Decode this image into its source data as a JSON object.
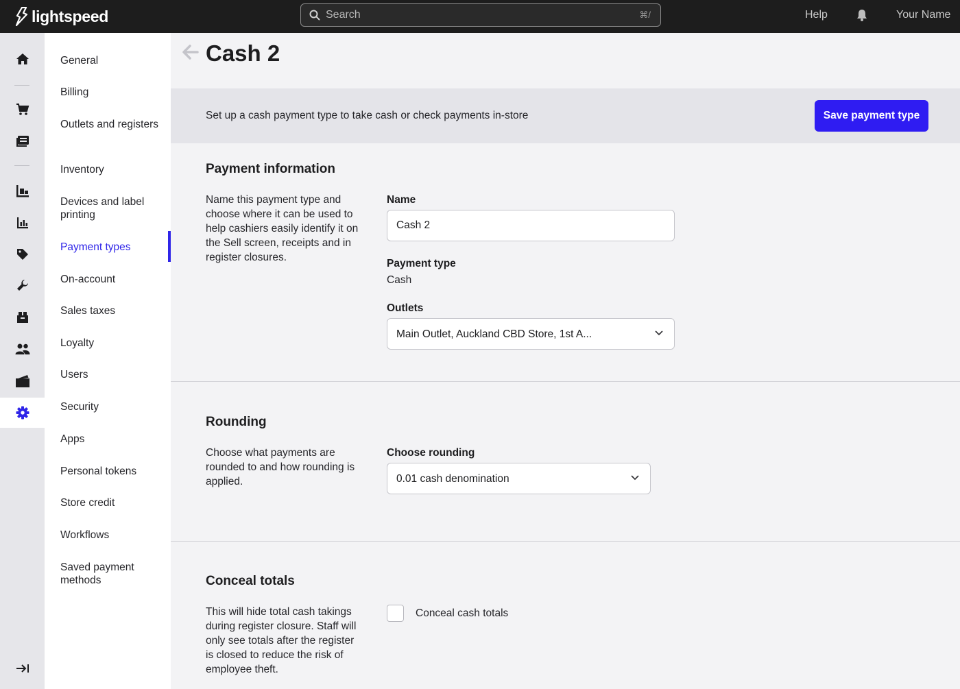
{
  "topbar": {
    "brand": "lightspeed",
    "search_placeholder": "Search",
    "search_shortcut": "⌘/",
    "help": "Help",
    "user_name": "Your Name"
  },
  "rail": {
    "icons": [
      "home-icon",
      "cart-icon",
      "register-icon",
      "products-icon",
      "reports-icon",
      "tag-icon",
      "wrench-icon",
      "inventory-icon",
      "customers-icon",
      "cash-icon",
      "settings-icon",
      "collapse-icon"
    ],
    "active": "settings-icon"
  },
  "sidebar": {
    "items": [
      {
        "label": "General"
      },
      {
        "label": "Billing"
      },
      {
        "label": "Outlets and registers"
      },
      {
        "label": "Inventory"
      },
      {
        "label": "Devices and label printing"
      },
      {
        "label": "Payment types"
      },
      {
        "label": "On-account"
      },
      {
        "label": "Sales taxes"
      },
      {
        "label": "Loyalty"
      },
      {
        "label": "Users"
      },
      {
        "label": "Security"
      },
      {
        "label": "Apps"
      },
      {
        "label": "Personal tokens"
      },
      {
        "label": "Store credit"
      },
      {
        "label": "Workflows"
      },
      {
        "label": "Saved payment methods"
      }
    ],
    "active": "Payment types"
  },
  "page": {
    "title": "Cash 2",
    "banner_text": "Set up a cash payment type to take cash or check payments in-store",
    "save_label": "Save payment type"
  },
  "payment_info": {
    "title": "Payment information",
    "description": "Name this payment type and choose where it can be used to help cashiers easily identify it on the Sell screen, receipts and in register closures.",
    "name_label": "Name",
    "name_value": "Cash 2",
    "type_label": "Payment type",
    "type_value": "Cash",
    "outlets_label": "Outlets",
    "outlets_value": "Main Outlet, Auckland CBD Store, 1st A..."
  },
  "rounding": {
    "title": "Rounding",
    "description": "Choose what payments are rounded to and how rounding is applied.",
    "label": "Choose rounding",
    "value": "0.01 cash denomination"
  },
  "conceal": {
    "title": "Conceal totals",
    "description": "This will hide total cash takings during register closure. Staff will only see totals after the register is closed to reduce the risk of employee theft.",
    "checkbox_label": "Conceal cash totals",
    "checked": false
  },
  "colors": {
    "accent": "#2f1cf2",
    "topbar": "#1d1d1d",
    "rail": "#e6e6ea",
    "main_bg": "#f3f3f5"
  }
}
